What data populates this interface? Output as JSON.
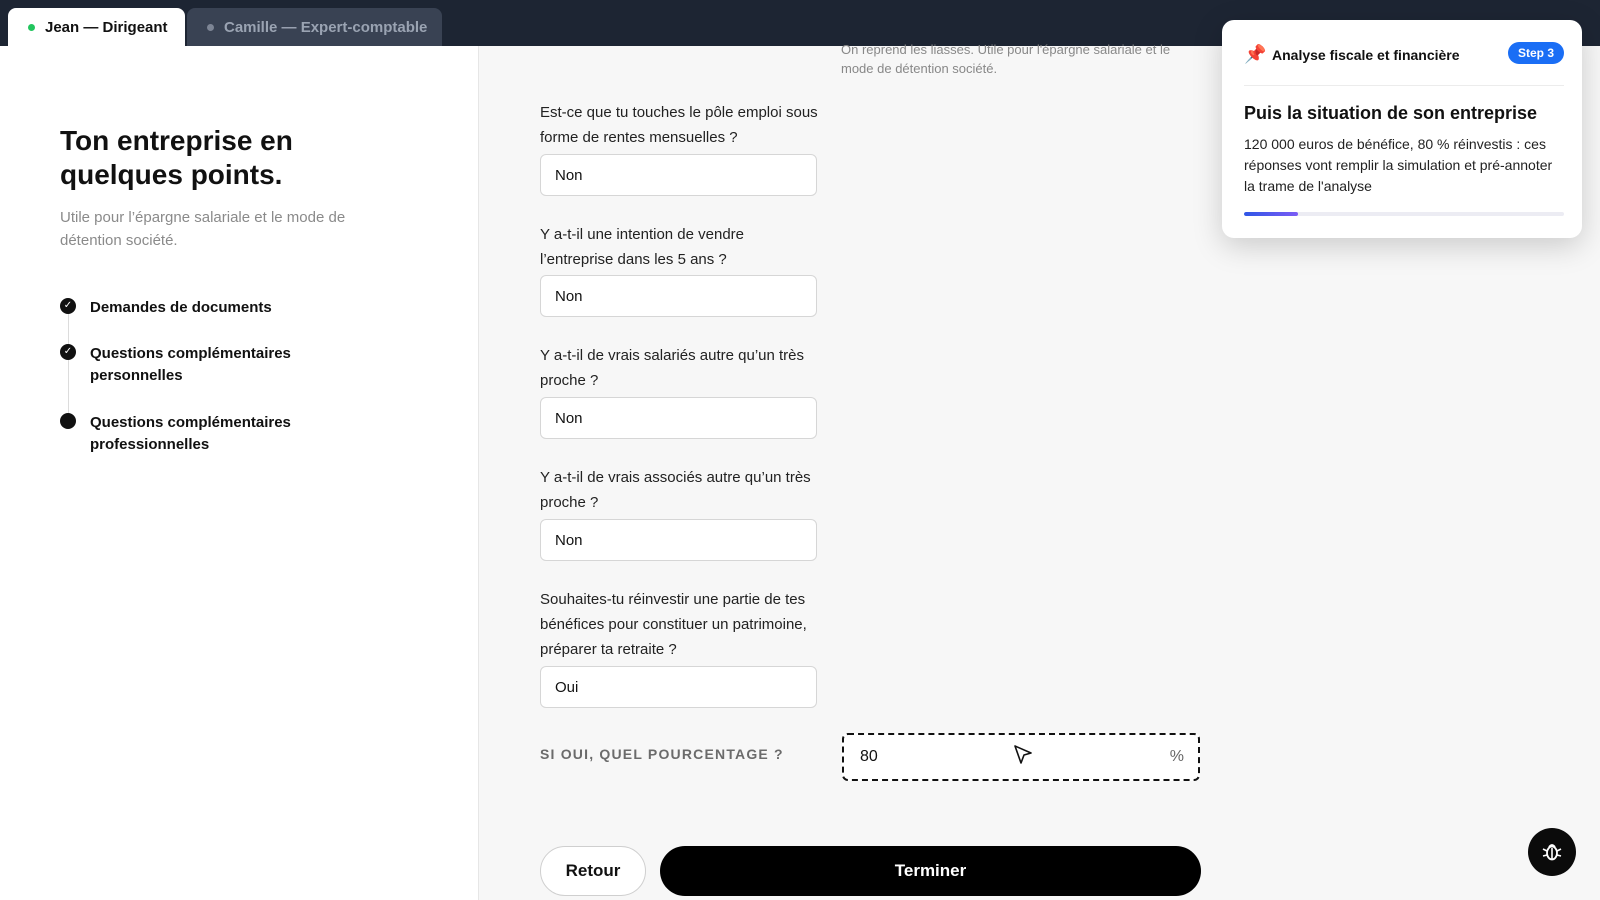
{
  "tabs": [
    {
      "label": "Jean — Dirigeant",
      "active": true
    },
    {
      "label": "Camille — Expert-comptable",
      "active": false
    }
  ],
  "left_panel": {
    "title": "Ton entreprise en quelques points.",
    "subtitle": "Utile pour l’épargne salariale et le mode de détention société.",
    "steps": [
      {
        "label": "Demandes de documents",
        "state": "done"
      },
      {
        "label": "Questions complémentaires personnelles",
        "state": "done"
      },
      {
        "label": "Questions complémentaires professionnelles",
        "state": "current"
      }
    ]
  },
  "form": {
    "cut_note": "On reprend les liasses. Utile pour l'épargne salariale et le mode de détention société.",
    "questions": [
      {
        "label": "Est-ce que tu touches le pôle emploi sous forme de rentes mensuelles ?",
        "value": "Non"
      },
      {
        "label": "Y a-t-il une intention de vendre l’entreprise dans les 5 ans ?",
        "value": "Non"
      },
      {
        "label": "Y a-t-il de vrais salariés autre qu’un très proche ?",
        "value": "Non"
      },
      {
        "label": "Y a-t-il de vrais associés autre qu’un très proche ?",
        "value": "Non"
      },
      {
        "label": "Souhaites-tu réinvestir une partie de tes bénéfices pour constituer un patrimoine, préparer ta retraite ?",
        "value": "Oui"
      }
    ],
    "percentage": {
      "label": "SI OUI, QUEL POURCENTAGE ?",
      "value": "80",
      "unit": "%"
    },
    "back_label": "Retour",
    "finish_label": "Terminer"
  },
  "tooltip": {
    "section": "Analyse fiscale et financière",
    "badge": "Step 3",
    "title": "Puis la situation de son entreprise",
    "body": "120 000 euros de bénéfice, 80 % réinvestis : ces réponses vont remplir la simulation et pré-annoter la trame de l'analyse",
    "progress": 0.17
  },
  "colors": {
    "accent": "#1a6ef5",
    "topbar": "#1d2533",
    "active_dot": "#22c55e"
  },
  "icons": {
    "pin": "pin-icon",
    "bug": "bug-icon",
    "check": "check-icon"
  }
}
